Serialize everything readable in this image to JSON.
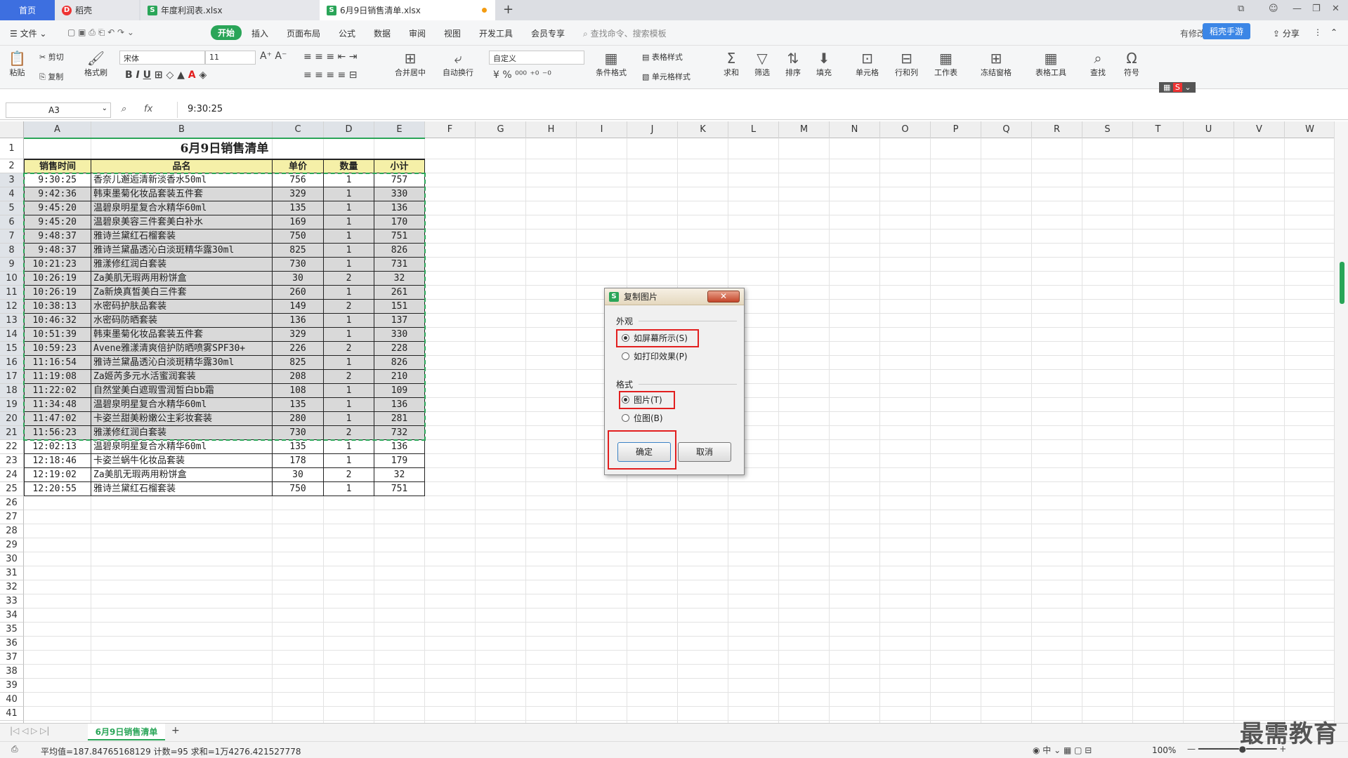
{
  "tabs": {
    "home": "首页",
    "t1": "稻壳",
    "t2": "年度利润表.xlsx",
    "t3": "6月9日销售清单.xlsx"
  },
  "menu": {
    "file": "文件",
    "items": [
      "开始",
      "插入",
      "页面布局",
      "公式",
      "数据",
      "审阅",
      "视图",
      "开发工具",
      "会员专享"
    ],
    "search": "查找命令、搜索模板",
    "share": "分享",
    "changes": "有修改",
    "cloud": "稻壳手游"
  },
  "ribbon": {
    "paste": "粘贴",
    "cut": "剪切",
    "copy": "复制",
    "format_painter": "格式刷",
    "font": "宋体",
    "size": "11",
    "merge": "合并居中",
    "wrap": "自动换行",
    "numfmt": "自定义",
    "cond": "条件格式",
    "tablestyle": "表格样式",
    "cellstyle": "单元格样式",
    "sum": "求和",
    "filter": "筛选",
    "sort": "排序",
    "fill": "填充",
    "cell": "单元格",
    "rowcol": "行和列",
    "sheet": "工作表",
    "freeze": "冻结窗格",
    "tabletool": "表格工具",
    "find": "查找",
    "symbol": "符号"
  },
  "formula": {
    "cell": "A3",
    "fx": "fx",
    "value": "9:30:25"
  },
  "columns": [
    "A",
    "B",
    "C",
    "D",
    "E",
    "F",
    "G",
    "H",
    "I",
    "J",
    "K",
    "L",
    "M",
    "N",
    "O",
    "P",
    "Q",
    "R",
    "S",
    "T",
    "U",
    "V",
    "W"
  ],
  "sheet": {
    "title": "6月9日销售清单",
    "headers": [
      "销售时间",
      "品名",
      "单价",
      "数量",
      "小计"
    ],
    "rows": [
      [
        "9:30:25",
        "香奈儿邂逅清新淡香水50ml",
        "756",
        "1",
        "757"
      ],
      [
        "9:42:36",
        "韩束墨菊化妆品套装五件套",
        "329",
        "1",
        "330"
      ],
      [
        "9:45:20",
        "温碧泉明星复合水精华60ml",
        "135",
        "1",
        "136"
      ],
      [
        "9:45:20",
        "温碧泉美容三件套美白补水",
        "169",
        "1",
        "170"
      ],
      [
        "9:48:37",
        "雅诗兰黛红石榴套装",
        "750",
        "1",
        "751"
      ],
      [
        "9:48:37",
        "雅诗兰黛晶透沁白淡斑精华露30ml",
        "825",
        "1",
        "826"
      ],
      [
        "10:21:23",
        "雅漾修红润白套装",
        "730",
        "1",
        "731"
      ],
      [
        "10:26:19",
        "Za美肌无瑕两用粉饼盒",
        "30",
        "2",
        "32"
      ],
      [
        "10:26:19",
        "Za新焕真皙美白三件套",
        "260",
        "1",
        "261"
      ],
      [
        "10:38:13",
        "水密码护肤品套装",
        "149",
        "2",
        "151"
      ],
      [
        "10:46:32",
        "水密码防晒套装",
        "136",
        "1",
        "137"
      ],
      [
        "10:51:39",
        "韩束墨菊化妆品套装五件套",
        "329",
        "1",
        "330"
      ],
      [
        "10:59:23",
        "Avene雅漾清爽倍护防晒喷雾SPF30+",
        "226",
        "2",
        "228"
      ],
      [
        "11:16:54",
        "雅诗兰黛晶透沁白淡斑精华露30ml",
        "825",
        "1",
        "826"
      ],
      [
        "11:19:08",
        "Za姬芮多元水活蜜润套装",
        "208",
        "2",
        "210"
      ],
      [
        "11:22:02",
        "自然堂美白遮瑕雪润皙白bb霜",
        "108",
        "1",
        "109"
      ],
      [
        "11:34:48",
        "温碧泉明星复合水精华60ml",
        "135",
        "1",
        "136"
      ],
      [
        "11:47:02",
        "卡姿兰甜美粉嫩公主彩妆套装",
        "280",
        "1",
        "281"
      ],
      [
        "11:56:23",
        "雅漾修红润白套装",
        "730",
        "2",
        "732"
      ],
      [
        "12:02:13",
        "温碧泉明星复合水精华60ml",
        "135",
        "1",
        "136"
      ],
      [
        "12:18:46",
        "卡姿兰蜗牛化妆品套装",
        "178",
        "1",
        "179"
      ],
      [
        "12:19:02",
        "Za美肌无瑕两用粉饼盒",
        "30",
        "2",
        "32"
      ],
      [
        "12:20:55",
        "雅诗兰黛红石榴套装",
        "750",
        "1",
        "751"
      ]
    ]
  },
  "dialog": {
    "title": "复制图片",
    "close": "✕",
    "group1": "外观",
    "opt1": "如屏幕所示(S)",
    "opt2": "如打印效果(P)",
    "group2": "格式",
    "opt3": "图片(T)",
    "opt4": "位图(B)",
    "ok": "确定",
    "cancel": "取消"
  },
  "sheet_tab": "6月9日销售清单",
  "status": "平均值=187.84765168129  计数=95  求和=1万4276.421527778",
  "zoom": "100%",
  "watermark": "最需教育",
  "colors": {
    "accent": "#2aa558",
    "highlight": "#e21f1f",
    "selection": "#d9d9d9"
  }
}
